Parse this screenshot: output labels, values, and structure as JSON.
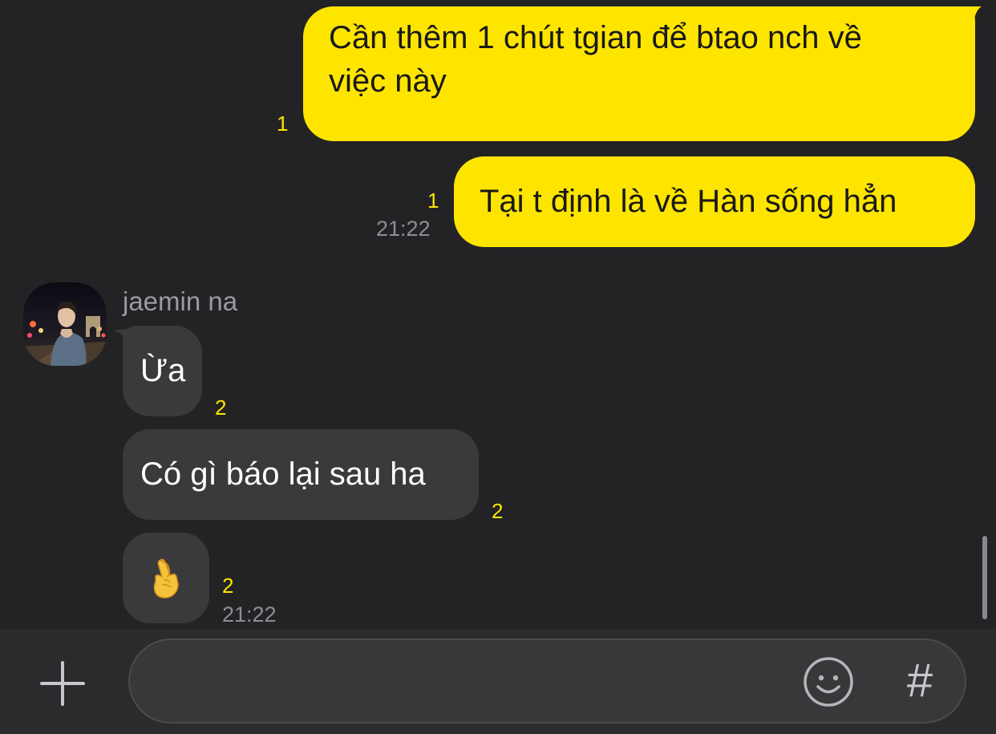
{
  "conversation": {
    "outgoing": [
      {
        "lines": [
          "Cần thêm 1 chút tgian để btao nch về",
          "việc này"
        ],
        "read_count": "1"
      },
      {
        "text": "Tại t định là về Hàn sống hẳn",
        "read_count": "1",
        "time": "21:22"
      }
    ],
    "sender": {
      "name": "jaemin na",
      "avatar_icon": "profile-photo"
    },
    "incoming": [
      {
        "text": "Ừa",
        "read_count": "2"
      },
      {
        "text": "Có gì báo lại sau ha",
        "read_count": "2"
      },
      {
        "emoji": "🤞",
        "emoji_icon": "crossed-fingers-emoji",
        "read_count": "2",
        "time": "21:22"
      }
    ]
  },
  "input_bar": {
    "placeholder": "",
    "add_icon": "plus-icon",
    "emoji_icon": "smiley-icon",
    "hashtag_label": "#"
  },
  "colors": {
    "background": "#232325",
    "outgoing_bubble": "#fee500",
    "incoming_bubble": "#3a3a3c",
    "read_count": "#fee500",
    "timestamp": "#8e8e93"
  }
}
